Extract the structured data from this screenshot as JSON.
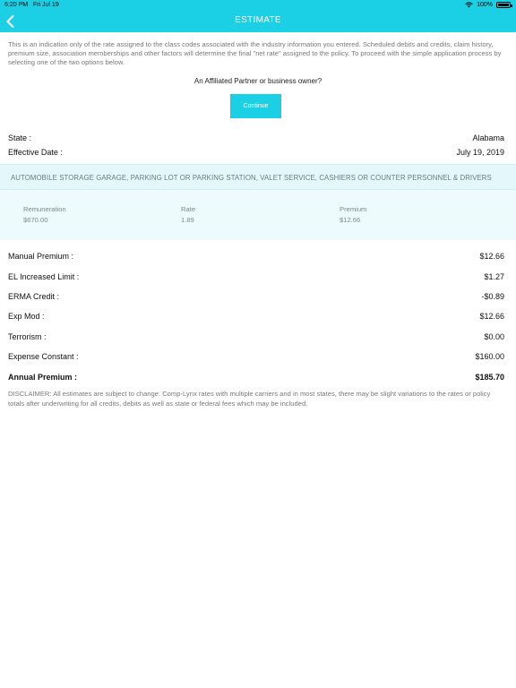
{
  "status_bar": {
    "time": "6:20 PM",
    "date": "Fri Jul 19",
    "battery": "100%"
  },
  "nav": {
    "title": "ESTIMATE"
  },
  "intro_text": "This is an indication only of the rate assigned to the class codes associated with the industry information you entered. Scheduled debits and credits, claim history, premium size, association memberships and other factors will determine the final \"net rate\" assigned to the policy. To proceed with the simple application process by selecting one of the two options below.",
  "partner_question": "An Affiliated Partner or business owner?",
  "continue_label": "Continue",
  "details": {
    "state_label": "State :",
    "state_value": "Alabama",
    "date_label": "Effective Date :",
    "date_value": "July 19, 2019"
  },
  "class_code": {
    "description": "AUTOMOBILE STORAGE GARAGE, PARKING LOT OR PARKING STATION, VALET SERVICE, CASHIERS OR COUNTER PERSONNEL & DRIVERS",
    "remuneration_label": "Remuneration",
    "remuneration_value": "$670.00",
    "rate_label": "Rate",
    "rate_value": "1.89",
    "premium_label": "Premium",
    "premium_value": "$12.66"
  },
  "premium_rows": [
    {
      "label": "Manual Premium :",
      "value": "$12.66"
    },
    {
      "label": "EL Increased Limit :",
      "value": "$1.27"
    },
    {
      "label": "ERMA Credit :",
      "value": "-$0.89"
    },
    {
      "label": "Exp Mod :",
      "value": "$12.66"
    },
    {
      "label": "Terrorism :",
      "value": "$0.00"
    },
    {
      "label": "Expense Constant :",
      "value": "$160.00"
    },
    {
      "label": "Annual Premium :",
      "value": "$185.70"
    }
  ],
  "disclaimer": "DISCLAIMER: All estimates are subject to change. Comp-Lynx rates with multiple carriers and in most states, there may be slight variations to the rates or policy totals after underwriting for all credits, debits as well as state or federal fees which may be included.",
  "colors": {
    "accent": "#1bcfe4",
    "band": "#e4f8fc"
  },
  "icons": {
    "back": "chevron-left-icon",
    "wifi": "wifi-icon",
    "battery": "battery-icon"
  }
}
